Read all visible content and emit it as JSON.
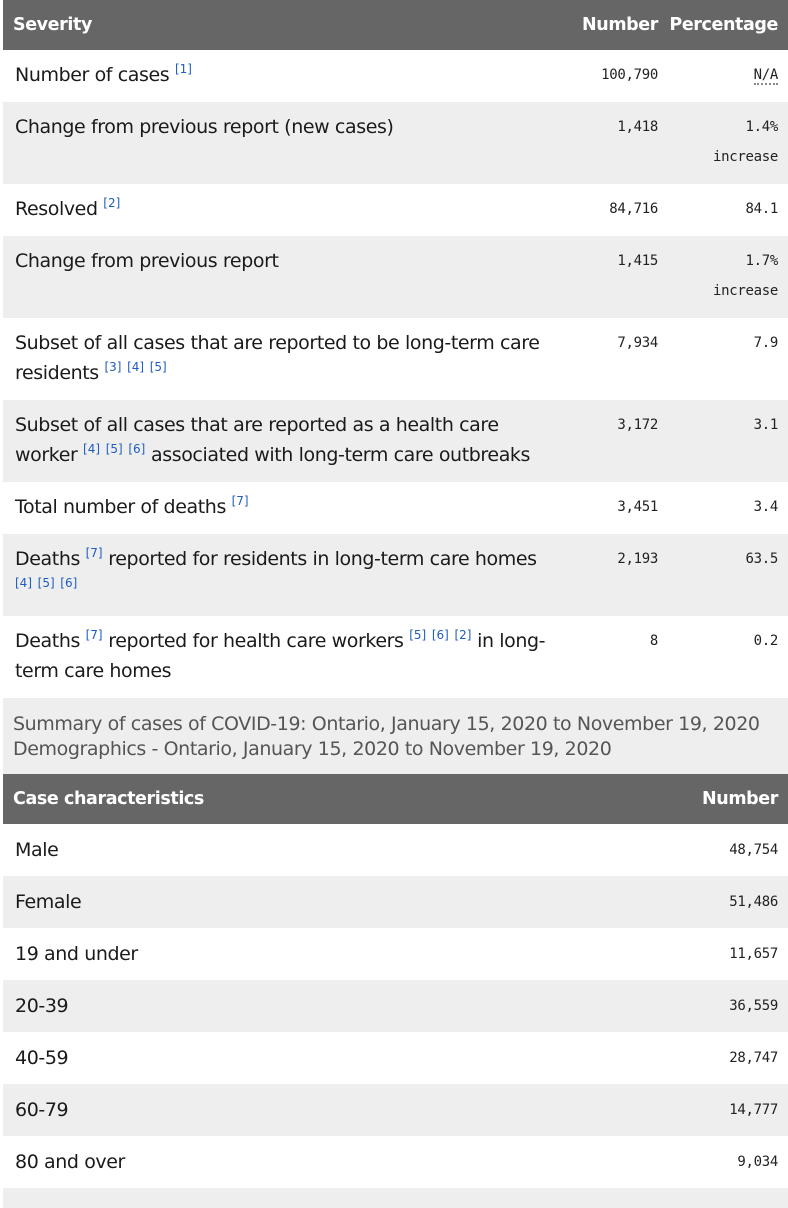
{
  "severity_table": {
    "headers": {
      "label": "Severity",
      "number": "Number",
      "percentage": "Percentage"
    },
    "rows": [
      {
        "label": "Number of cases",
        "refs": [
          "[1]"
        ],
        "number": "100,790",
        "percentage": "N/A"
      },
      {
        "label": "Change from previous report (new cases)",
        "refs": [],
        "number": "1,418",
        "percentage": "1.4% increase"
      },
      {
        "label": "Resolved",
        "refs": [
          "[2]"
        ],
        "number": "84,716",
        "percentage": "84.1"
      },
      {
        "label": "Change from previous report",
        "refs": [],
        "number": "1,415",
        "percentage": "1.7% increase"
      },
      {
        "label_pre": "Subset of all cases that are reported to be long-term care residents",
        "refs": [
          "[3]",
          "[4]",
          "[5]"
        ],
        "number": "7,934",
        "percentage": "7.9"
      },
      {
        "label_pre": "Subset of all cases that are reported as a health care worker",
        "refs": [
          "[4]",
          "[5]",
          "[6]"
        ],
        "label_post": "associated with long-term care outbreaks",
        "number": "3,172",
        "percentage": "3.1"
      },
      {
        "label": "Total number of deaths",
        "refs": [
          "[7]"
        ],
        "number": "3,451",
        "percentage": "3.4"
      },
      {
        "label_pre": "Deaths",
        "refs_mid": [
          "[7]"
        ],
        "label_mid": "reported for residents in long-term care homes",
        "refs": [
          "[4]",
          "[5]",
          "[6]"
        ],
        "number": "2,193",
        "percentage": "63.5"
      },
      {
        "label_pre": "Deaths",
        "refs_mid": [
          "[7]"
        ],
        "label_mid": "reported for health care workers",
        "refs": [
          "[5]",
          "[6]",
          "[2]"
        ],
        "label_post": "in long-term care homes",
        "number": "8",
        "percentage": "0.2"
      }
    ]
  },
  "captions": {
    "summary": "Summary of cases of COVID-19: Ontario, January 15, 2020 to November 19, 2020",
    "demographics": "Demographics - Ontario, January 15, 2020 to November 19, 2020"
  },
  "demographics_table": {
    "headers": {
      "label": "Case characteristics",
      "number": "Number"
    },
    "rows": [
      {
        "label": "Male",
        "number": "48,754"
      },
      {
        "label": "Female",
        "number": "51,486"
      },
      {
        "label": "19 and under",
        "number": "11,657"
      },
      {
        "label": "20-39",
        "number": "36,559"
      },
      {
        "label": "40-59",
        "number": "28,747"
      },
      {
        "label": "60-79",
        "number": "14,777"
      },
      {
        "label": "80 and over",
        "number": "9,034"
      }
    ]
  },
  "colors": {
    "header_bg": "#666666",
    "alt_row_bg": "#eeeeee",
    "ref_link": "#1f5ebf"
  }
}
